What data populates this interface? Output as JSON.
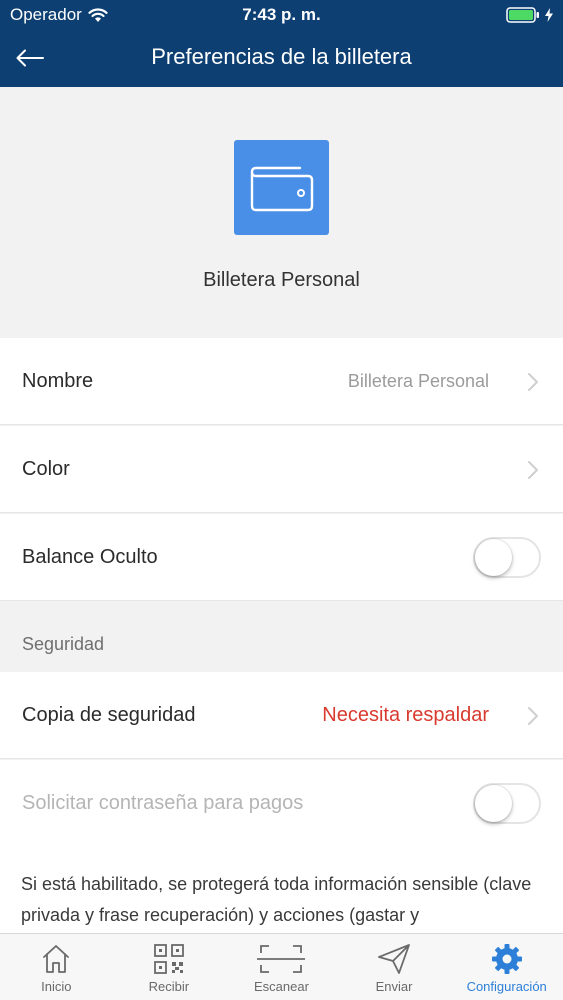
{
  "status_bar": {
    "carrier": "Operador",
    "time": "7:43 p. m."
  },
  "nav": {
    "title": "Preferencias de la billetera"
  },
  "wallet": {
    "name": "Billetera Personal",
    "icon": "wallet-icon",
    "icon_color": "#4a8fe7"
  },
  "settings": {
    "nombre_label": "Nombre",
    "nombre_value": "Billetera Personal",
    "color_label": "Color",
    "balance_oculto_label": "Balance Oculto",
    "balance_oculto_on": false
  },
  "security": {
    "section_title": "Seguridad",
    "backup_label": "Copia de seguridad",
    "backup_status": "Necesita respaldar",
    "backup_status_color": "#d93a2e",
    "password_label": "Solicitar contraseña para pagos",
    "password_on": false,
    "description": "Si está habilitado, se protegerá toda información sensible (clave privada y frase recuperación) y acciones (gastar y"
  },
  "tabs": [
    {
      "label": "Inicio",
      "icon": "home-icon"
    },
    {
      "label": "Recibir",
      "icon": "qr-code-icon"
    },
    {
      "label": "Escanear",
      "icon": "scan-icon"
    },
    {
      "label": "Enviar",
      "icon": "send-icon"
    },
    {
      "label": "Configuración",
      "icon": "gear-icon",
      "active": true
    }
  ],
  "colors": {
    "header": "#0d3f73",
    "accent": "#2d7fd8"
  }
}
